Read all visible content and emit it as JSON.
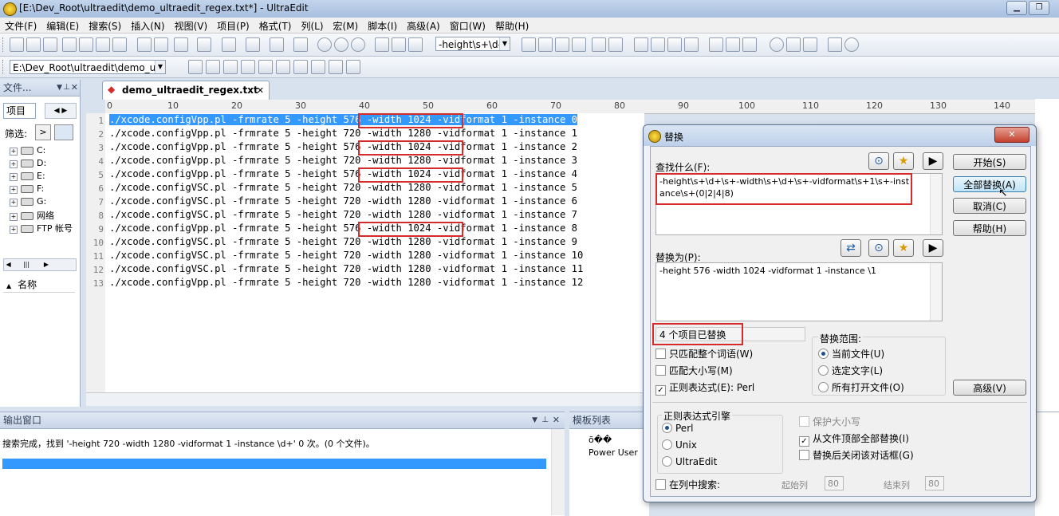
{
  "window": {
    "title": "[E:\\Dev_Root\\ultraedit\\demo_ultraedit_regex.txt*] - UltraEdit"
  },
  "menu": [
    "文件(F)",
    "编辑(E)",
    "搜索(S)",
    "插入(N)",
    "视图(V)",
    "项目(P)",
    "格式(T)",
    "列(L)",
    "宏(M)",
    "脚本(I)",
    "高级(A)",
    "窗口(W)",
    "帮助(H)"
  ],
  "toolbar": {
    "search_combo": "-height\\s+\\d-",
    "path_combo": "E:\\Dev_Root\\ultraedit\\demo_ul"
  },
  "left_panel": {
    "header": "文件...",
    "tab_label": "项目",
    "filter_label": "筛选:",
    "drives": [
      "C:",
      "D:",
      "E:",
      "F:",
      "G:",
      "网络",
      "FTP 帐号"
    ],
    "sort_label": "名称"
  },
  "editor": {
    "tab_label": "demo_ultraedit_regex.txt",
    "ruler_labels": [
      "0",
      "10",
      "20",
      "30",
      "40",
      "50",
      "60",
      "70",
      "80",
      "90",
      "100",
      "110",
      "120",
      "130",
      "140"
    ],
    "lines": [
      {
        "n": "1",
        "text": "./xcode.configVpp.pl -frmrate 5 -height 576 -width 1024 -vidformat 1 -instance 0"
      },
      {
        "n": "2",
        "text": "./xcode.configVpp.pl -frmrate 5 -height 720 -width 1280 -vidformat 1 -instance 1"
      },
      {
        "n": "3",
        "text": "./xcode.configVpp.pl -frmrate 5 -height 576 -width 1024 -vidformat 1 -instance 2"
      },
      {
        "n": "4",
        "text": "./xcode.configVpp.pl -frmrate 5 -height 720 -width 1280 -vidformat 1 -instance 3"
      },
      {
        "n": "5",
        "text": "./xcode.configVpp.pl -frmrate 5 -height 576 -width 1024 -vidformat 1 -instance 4"
      },
      {
        "n": "6",
        "text": "./xcode.configVSC.pl -frmrate 5 -height 720 -width 1280 -vidformat 1 -instance 5"
      },
      {
        "n": "7",
        "text": "./xcode.configVSC.pl -frmrate 5 -height 720 -width 1280 -vidformat 1 -instance 6"
      },
      {
        "n": "8",
        "text": "./xcode.configVSC.pl -frmrate 5 -height 720 -width 1280 -vidformat 1 -instance 7"
      },
      {
        "n": "9",
        "text": "./xcode.configVpp.pl -frmrate 5 -height 576 -width 1024 -vidformat 1 -instance 8"
      },
      {
        "n": "10",
        "text": "./xcode.configVSC.pl -frmrate 5 -height 720 -width 1280 -vidformat 1 -instance 9"
      },
      {
        "n": "11",
        "text": "./xcode.configVSC.pl -frmrate 5 -height 720 -width 1280 -vidformat 1 -instance 10"
      },
      {
        "n": "12",
        "text": "./xcode.configVSC.pl -frmrate 5 -height 720 -width 1280 -vidformat 1 -instance 11"
      },
      {
        "n": "13",
        "text": "./xcode.configVpp.pl -frmrate 5 -height 720 -width 1280 -vidformat 1 -instance 12"
      }
    ]
  },
  "output": {
    "header": "输出窗口",
    "message": "搜索完成，找到 '-height 720 -width 1280 -vidformat 1 -instance \\d+' 0 次。(0 个文件)。"
  },
  "templates": {
    "header": "模板列表",
    "root": "õ��",
    "item": "Power User"
  },
  "dialog": {
    "title": "替换",
    "find_label": "查找什么(F):",
    "find_value": "-height\\s+\\d+\\s+-width\\s+\\d+\\s+-vidformat\\s+1\\s+-instance\\s+(0|2|4|8)",
    "replace_label": "替换为(P):",
    "replace_value": "-height 576 -width 1024 -vidformat 1 -instance \\1",
    "status": "4 个项目已替换",
    "buttons": {
      "start": "开始(S)",
      "replace_all": "全部替换(A)",
      "cancel": "取消(C)",
      "help": "帮助(H)",
      "advanced": "高级(V)"
    },
    "options": {
      "whole_word": "只匹配整个词语(W)",
      "match_case": "匹配大小写(M)",
      "regex": "正则表达式(E): Perl"
    },
    "scope": {
      "label": "替换范围:",
      "current_file": "当前文件(U)",
      "selected_text": "选定文字(L)",
      "all_open": "所有打开文件(O)"
    },
    "engine": {
      "label": "正则表达式引擎",
      "perl": "Perl",
      "unix": "Unix",
      "ultraedit": "UltraEdit"
    },
    "right_options": {
      "preserve_case": "保护大小写",
      "from_top": "从文件顶部全部替换(I)",
      "close_after": "替换后关闭该对话框(G)"
    },
    "column": {
      "label": "在列中搜索:",
      "start_label": "起始列",
      "start_value": "80",
      "end_label": "结束列",
      "end_value": "80"
    }
  }
}
